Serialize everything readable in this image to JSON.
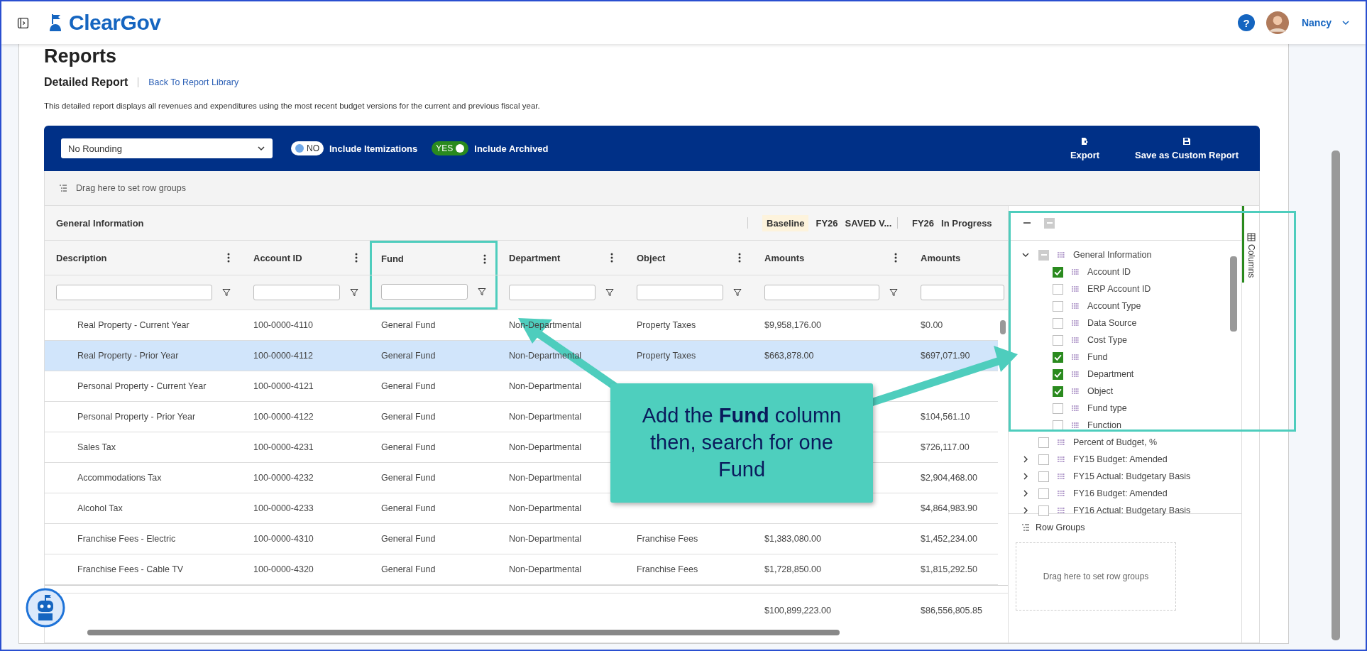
{
  "header": {
    "logo": "ClearGov",
    "help": "?",
    "user": "Nancy"
  },
  "page": {
    "title": "Reports",
    "subtitle": "Detailed Report",
    "link": "Back To Report Library",
    "description": "This detailed report displays all revenues and expenditures using the most recent budget versions for the current and previous fiscal year."
  },
  "toolbar": {
    "rounding": "No Rounding",
    "toggles": [
      {
        "state": "NO",
        "label": "Include Itemizations",
        "on": false
      },
      {
        "state": "YES",
        "label": "Include Archived",
        "on": true
      }
    ],
    "actions": [
      {
        "kind": "export",
        "label": "Export"
      },
      {
        "kind": "save",
        "label": "Save as Custom Report"
      }
    ]
  },
  "row_group_hint": "Drag here to set row groups",
  "table": {
    "groups": [
      {
        "label": "General Information"
      },
      {
        "badge": "Baseline",
        "year": "FY26",
        "label": "SAVED V..."
      },
      {
        "year": "FY26",
        "label": "In Progress"
      }
    ],
    "columns": [
      {
        "label": "Description",
        "menu": true,
        "highlighted": false
      },
      {
        "label": "Account ID",
        "menu": true,
        "highlighted": false
      },
      {
        "label": "Fund",
        "menu": true,
        "highlighted": true
      },
      {
        "label": "Department",
        "menu": true,
        "highlighted": false
      },
      {
        "label": "Object",
        "menu": true,
        "highlighted": false
      },
      {
        "label": "Amounts",
        "menu": true,
        "highlighted": false
      },
      {
        "label": "Amounts",
        "menu": false,
        "highlighted": false
      }
    ],
    "rows": [
      {
        "selected": false,
        "cells": [
          "Real Property - Current Year",
          "100-0000-4110",
          "General Fund",
          "Non-Departmental",
          "Property Taxes",
          "$9,958,176.00",
          "$0.00"
        ]
      },
      {
        "selected": true,
        "cells": [
          "Real Property - Prior Year",
          "100-0000-4112",
          "General Fund",
          "Non-Departmental",
          "Property Taxes",
          "$663,878.00",
          "$697,071.90"
        ]
      },
      {
        "selected": false,
        "cells": [
          "Personal Property - Current Year",
          "100-0000-4121",
          "General Fund",
          "Non-Departmental",
          null,
          null,
          null
        ]
      },
      {
        "selected": false,
        "cells": [
          "Personal Property - Prior Year",
          "100-0000-4122",
          "General Fund",
          "Non-Departmental",
          null,
          null,
          "$104,561.10"
        ]
      },
      {
        "selected": false,
        "cells": [
          "Sales Tax",
          "100-0000-4231",
          "General Fund",
          "Non-Departmental",
          null,
          null,
          "$726,117.00"
        ]
      },
      {
        "selected": false,
        "cells": [
          "Accommodations Tax",
          "100-0000-4232",
          "General Fund",
          "Non-Departmental",
          null,
          null,
          "$2,904,468.00"
        ]
      },
      {
        "selected": false,
        "cells": [
          "Alcohol Tax",
          "100-0000-4233",
          "General Fund",
          "Non-Departmental",
          null,
          null,
          "$4,864,983.90"
        ]
      },
      {
        "selected": false,
        "cells": [
          "Franchise Fees - Electric",
          "100-0000-4310",
          "General Fund",
          "Non-Departmental",
          "Franchise Fees",
          "$1,383,080.00",
          "$1,452,234.00"
        ]
      },
      {
        "selected": false,
        "cells": [
          "Franchise Fees - Cable TV",
          "100-0000-4320",
          "General Fund",
          "Non-Departmental",
          "Franchise Fees",
          "$1,728,850.00",
          "$1,815,292.50"
        ]
      }
    ],
    "totals": [
      "$100,899,223.00",
      "$86,556,805.85"
    ]
  },
  "column_panel": {
    "select_all_indeterminate": true,
    "side_tab": "Columns",
    "items": [
      {
        "label": "General Information",
        "expandable": true,
        "expanded": true,
        "checked": false,
        "indeterminate": true,
        "children": [
          {
            "label": "Account ID",
            "checked": true
          },
          {
            "label": "ERP Account ID",
            "checked": false
          },
          {
            "label": "Account Type",
            "checked": false
          },
          {
            "label": "Data Source",
            "checked": false
          },
          {
            "label": "Cost Type",
            "checked": false
          },
          {
            "label": "Fund",
            "checked": true
          },
          {
            "label": "Department",
            "checked": true
          },
          {
            "label": "Object",
            "checked": true
          },
          {
            "label": "Fund type",
            "checked": false
          },
          {
            "label": "Function",
            "checked": false
          }
        ]
      },
      {
        "label": "Percent of Budget, %",
        "expandable": false,
        "checked": false
      },
      {
        "label": "FY15 Budget: Amended",
        "expandable": true,
        "expanded": false,
        "checked": false
      },
      {
        "label": "FY15 Actual: Budgetary Basis",
        "expandable": true,
        "expanded": false,
        "checked": false
      },
      {
        "label": "FY16 Budget: Amended",
        "expandable": true,
        "expanded": false,
        "checked": false
      },
      {
        "label": "FY16 Actual: Budgetary Basis",
        "expandable": true,
        "expanded": false,
        "checked": false
      }
    ],
    "row_groups": {
      "title": "Row Groups",
      "hint": "Drag here to set row groups"
    }
  },
  "callout": {
    "text": "Add the **Fund** column then, search for one Fund"
  }
}
